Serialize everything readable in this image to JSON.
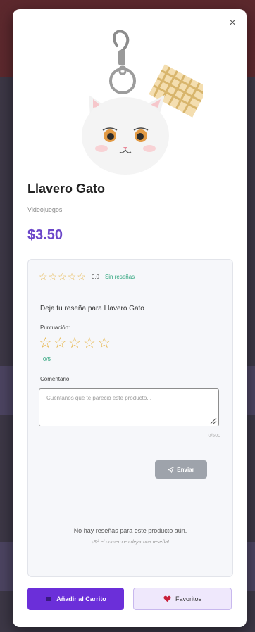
{
  "modal": {
    "close_label": "×"
  },
  "product": {
    "title": "Llavero Gato",
    "category": "Videojuegos",
    "price": "$3.50",
    "image_icon": "cat-keychain-image"
  },
  "reviews": {
    "summary_stars": 5,
    "average": "0.0",
    "no_reviews_link": "Sin reseñas",
    "form_heading": "Deja tu reseña para Llavero Gato",
    "score_label": "Puntuación:",
    "score_value": "0/5",
    "input_stars": 5,
    "comment_label": "Comentario:",
    "comment_value": "",
    "comment_placeholder": "Cuéntanos qué te pareció este producto...",
    "char_count": "0/500",
    "send_label": "Enviar",
    "empty_message": "No hay reseñas para este producto aún.",
    "empty_sub": "¡Sé el primero en dejar una reseña!"
  },
  "actions": {
    "cart_label": "Añadir al Carrito",
    "favorites_label": "Favoritos"
  },
  "colors": {
    "accent": "#6b2fd9",
    "price": "#6b46c9",
    "star": "#e7b548",
    "success_text": "#2aa37a"
  }
}
